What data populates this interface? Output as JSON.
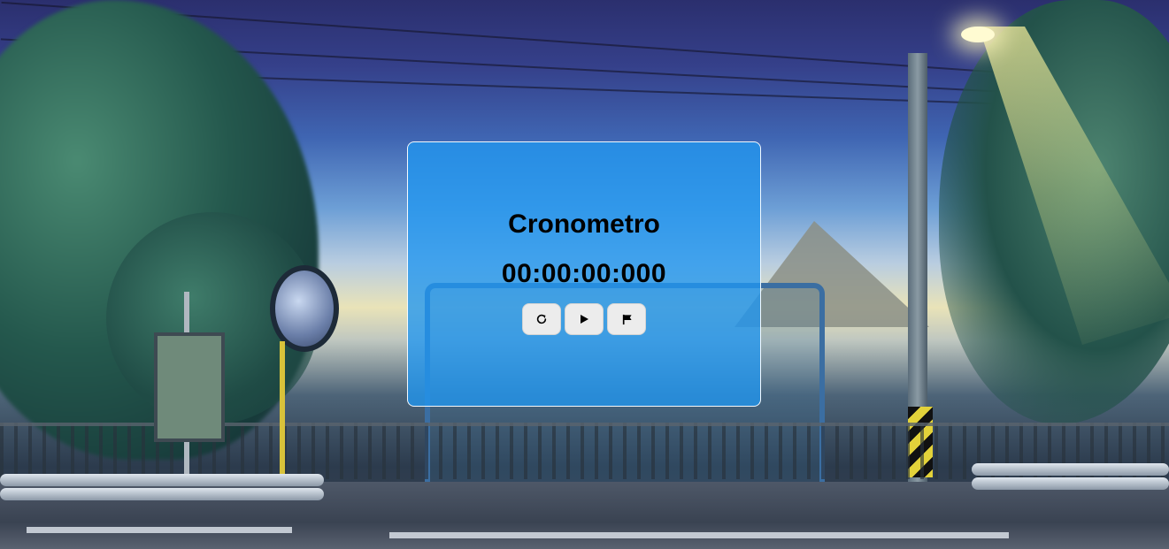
{
  "stopwatch": {
    "title": "Cronometro",
    "time": "00:00:00:000",
    "buttons": [
      {
        "name": "reset-button",
        "icon": "reset-icon"
      },
      {
        "name": "play-button",
        "icon": "play-icon"
      },
      {
        "name": "lap-button",
        "icon": "flag-icon"
      }
    ]
  },
  "colors": {
    "card_background": "#2096f0",
    "button_background": "#ececec",
    "text": "#000000"
  }
}
